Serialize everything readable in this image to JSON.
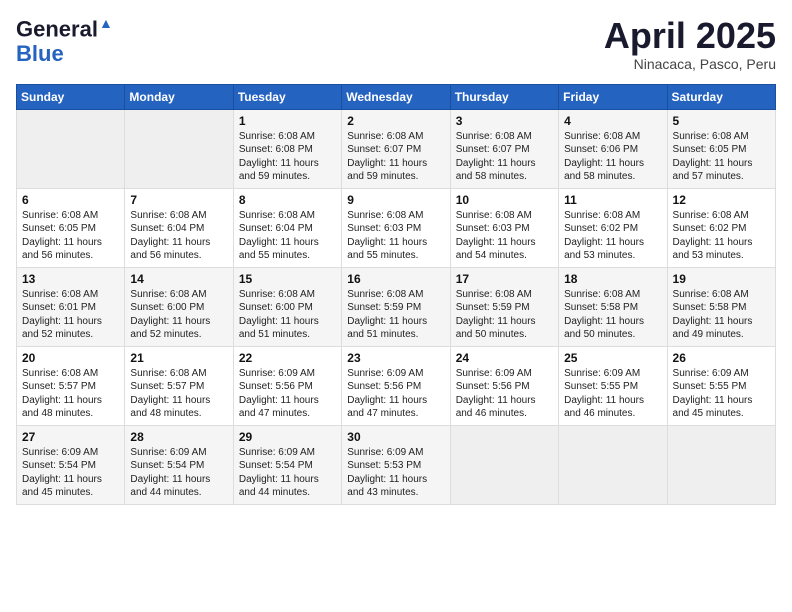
{
  "header": {
    "logo_line1": "General",
    "logo_line2": "Blue",
    "month": "April 2025",
    "location": "Ninacaca, Pasco, Peru"
  },
  "weekdays": [
    "Sunday",
    "Monday",
    "Tuesday",
    "Wednesday",
    "Thursday",
    "Friday",
    "Saturday"
  ],
  "weeks": [
    [
      {
        "day": "",
        "info": ""
      },
      {
        "day": "",
        "info": ""
      },
      {
        "day": "1",
        "info": "Sunrise: 6:08 AM\nSunset: 6:08 PM\nDaylight: 11 hours and 59 minutes."
      },
      {
        "day": "2",
        "info": "Sunrise: 6:08 AM\nSunset: 6:07 PM\nDaylight: 11 hours and 59 minutes."
      },
      {
        "day": "3",
        "info": "Sunrise: 6:08 AM\nSunset: 6:07 PM\nDaylight: 11 hours and 58 minutes."
      },
      {
        "day": "4",
        "info": "Sunrise: 6:08 AM\nSunset: 6:06 PM\nDaylight: 11 hours and 58 minutes."
      },
      {
        "day": "5",
        "info": "Sunrise: 6:08 AM\nSunset: 6:05 PM\nDaylight: 11 hours and 57 minutes."
      }
    ],
    [
      {
        "day": "6",
        "info": "Sunrise: 6:08 AM\nSunset: 6:05 PM\nDaylight: 11 hours and 56 minutes."
      },
      {
        "day": "7",
        "info": "Sunrise: 6:08 AM\nSunset: 6:04 PM\nDaylight: 11 hours and 56 minutes."
      },
      {
        "day": "8",
        "info": "Sunrise: 6:08 AM\nSunset: 6:04 PM\nDaylight: 11 hours and 55 minutes."
      },
      {
        "day": "9",
        "info": "Sunrise: 6:08 AM\nSunset: 6:03 PM\nDaylight: 11 hours and 55 minutes."
      },
      {
        "day": "10",
        "info": "Sunrise: 6:08 AM\nSunset: 6:03 PM\nDaylight: 11 hours and 54 minutes."
      },
      {
        "day": "11",
        "info": "Sunrise: 6:08 AM\nSunset: 6:02 PM\nDaylight: 11 hours and 53 minutes."
      },
      {
        "day": "12",
        "info": "Sunrise: 6:08 AM\nSunset: 6:02 PM\nDaylight: 11 hours and 53 minutes."
      }
    ],
    [
      {
        "day": "13",
        "info": "Sunrise: 6:08 AM\nSunset: 6:01 PM\nDaylight: 11 hours and 52 minutes."
      },
      {
        "day": "14",
        "info": "Sunrise: 6:08 AM\nSunset: 6:00 PM\nDaylight: 11 hours and 52 minutes."
      },
      {
        "day": "15",
        "info": "Sunrise: 6:08 AM\nSunset: 6:00 PM\nDaylight: 11 hours and 51 minutes."
      },
      {
        "day": "16",
        "info": "Sunrise: 6:08 AM\nSunset: 5:59 PM\nDaylight: 11 hours and 51 minutes."
      },
      {
        "day": "17",
        "info": "Sunrise: 6:08 AM\nSunset: 5:59 PM\nDaylight: 11 hours and 50 minutes."
      },
      {
        "day": "18",
        "info": "Sunrise: 6:08 AM\nSunset: 5:58 PM\nDaylight: 11 hours and 50 minutes."
      },
      {
        "day": "19",
        "info": "Sunrise: 6:08 AM\nSunset: 5:58 PM\nDaylight: 11 hours and 49 minutes."
      }
    ],
    [
      {
        "day": "20",
        "info": "Sunrise: 6:08 AM\nSunset: 5:57 PM\nDaylight: 11 hours and 48 minutes."
      },
      {
        "day": "21",
        "info": "Sunrise: 6:08 AM\nSunset: 5:57 PM\nDaylight: 11 hours and 48 minutes."
      },
      {
        "day": "22",
        "info": "Sunrise: 6:09 AM\nSunset: 5:56 PM\nDaylight: 11 hours and 47 minutes."
      },
      {
        "day": "23",
        "info": "Sunrise: 6:09 AM\nSunset: 5:56 PM\nDaylight: 11 hours and 47 minutes."
      },
      {
        "day": "24",
        "info": "Sunrise: 6:09 AM\nSunset: 5:56 PM\nDaylight: 11 hours and 46 minutes."
      },
      {
        "day": "25",
        "info": "Sunrise: 6:09 AM\nSunset: 5:55 PM\nDaylight: 11 hours and 46 minutes."
      },
      {
        "day": "26",
        "info": "Sunrise: 6:09 AM\nSunset: 5:55 PM\nDaylight: 11 hours and 45 minutes."
      }
    ],
    [
      {
        "day": "27",
        "info": "Sunrise: 6:09 AM\nSunset: 5:54 PM\nDaylight: 11 hours and 45 minutes."
      },
      {
        "day": "28",
        "info": "Sunrise: 6:09 AM\nSunset: 5:54 PM\nDaylight: 11 hours and 44 minutes."
      },
      {
        "day": "29",
        "info": "Sunrise: 6:09 AM\nSunset: 5:54 PM\nDaylight: 11 hours and 44 minutes."
      },
      {
        "day": "30",
        "info": "Sunrise: 6:09 AM\nSunset: 5:53 PM\nDaylight: 11 hours and 43 minutes."
      },
      {
        "day": "",
        "info": ""
      },
      {
        "day": "",
        "info": ""
      },
      {
        "day": "",
        "info": ""
      }
    ]
  ]
}
